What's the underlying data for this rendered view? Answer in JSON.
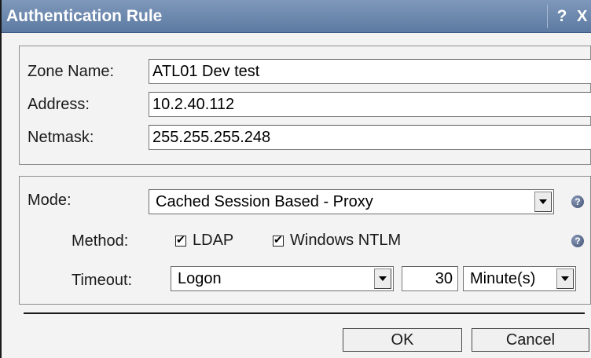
{
  "window": {
    "title": "Authentication Rule",
    "help_label": "?",
    "close_label": "X"
  },
  "zone": {
    "zone_name_label": "Zone Name:",
    "zone_name_value": "ATL01 Dev test",
    "address_label": "Address:",
    "address_value": "10.2.40.112",
    "netmask_label": "Netmask:",
    "netmask_value": "255.255.255.248"
  },
  "auth": {
    "mode_label": "Mode:",
    "mode_value": "Cached Session Based - Proxy",
    "method_label": "Method:",
    "methods": [
      {
        "label": "LDAP",
        "checked": true
      },
      {
        "label": "Windows NTLM",
        "checked": true
      }
    ],
    "timeout_label": "Timeout:",
    "timeout_type": "Logon",
    "timeout_value": "30",
    "timeout_unit": "Minute(s)"
  },
  "buttons": {
    "ok_label": "OK",
    "cancel_label": "Cancel"
  },
  "icons": {
    "help": "question-circle-icon",
    "dropdown": "chevron-down-icon"
  },
  "colors": {
    "titlebar": "#6b86ad",
    "dialog_bg": "#f3f3f3"
  }
}
